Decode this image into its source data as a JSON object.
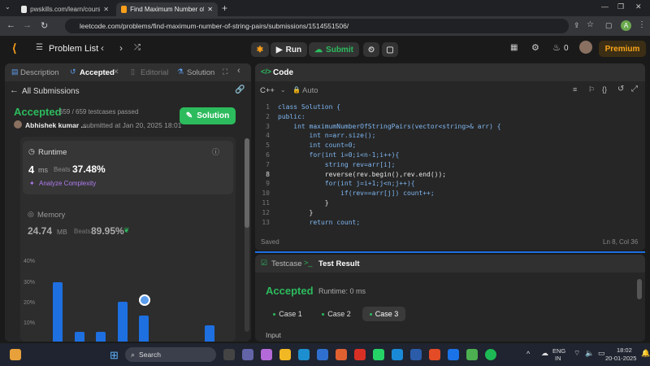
{
  "browser": {
    "tab1": "pwskills.com/learn/course/deci",
    "tab2": "Find Maximum Number of String",
    "url": "leetcode.com/problems/find-maximum-number-of-string-pairs/submissions/1514551506/"
  },
  "topbar": {
    "problem_list": "Problem List",
    "run": "Run",
    "submit": "Submit",
    "streak": "0",
    "premium": "Premium"
  },
  "left": {
    "tabs": {
      "description": "Description",
      "accepted": "Accepted",
      "editorial": "Editorial",
      "solutions": "Solution"
    },
    "all_submissions": "All Submissions",
    "status": "Accepted",
    "testcases": "659 / 659 testcases passed",
    "user": "Abhishek kumar ...",
    "submitted": "submitted at Jan 20, 2025 18:01",
    "solution_btn": "Solution",
    "runtime": {
      "label": "Runtime",
      "value": "4",
      "unit": "ms",
      "beats_label": "Beats",
      "beats": "37.48%",
      "analyze": "Analyze Complexity"
    },
    "memory": {
      "label": "Memory",
      "value": "24.74",
      "unit": "MB",
      "beats_label": "Beats",
      "beats": "89.95%"
    }
  },
  "chart_data": {
    "type": "bar",
    "yticks": [
      "40%",
      "30%",
      "20%",
      "10%"
    ],
    "ylim": [
      0,
      40
    ],
    "values": [
      30,
      5,
      5,
      20,
      13,
      0,
      0,
      8
    ]
  },
  "code": {
    "title": "Code",
    "lang": "C++",
    "mode": "Auto",
    "saved": "Saved",
    "position": "Ln 8, Col 36",
    "lines": [
      "class Solution {",
      "public:",
      "    int maximumNumberOfStringPairs(vector<string>& arr) {",
      "        int n=arr.size();",
      "        int count=0;",
      "        for(int i=0;i<n-1;i++){",
      "            string rev=arr[i];",
      "            reverse(rev.begin(),rev.end());",
      "            for(int j=i+1;j<n;j++){",
      "                if(rev==arr[j]) count++;",
      "            }",
      "        }",
      "        return count;"
    ]
  },
  "result": {
    "testcase_tab": "Testcase",
    "result_tab": "Test Result",
    "status": "Accepted",
    "runtime": "Runtime: 0 ms",
    "cases": [
      "Case 1",
      "Case 2",
      "Case 3"
    ],
    "input": "Input"
  },
  "taskbar": {
    "search": "Search",
    "lang1": "ENG",
    "lang2": "IN",
    "time": "18:02",
    "date": "20-01-2025"
  }
}
